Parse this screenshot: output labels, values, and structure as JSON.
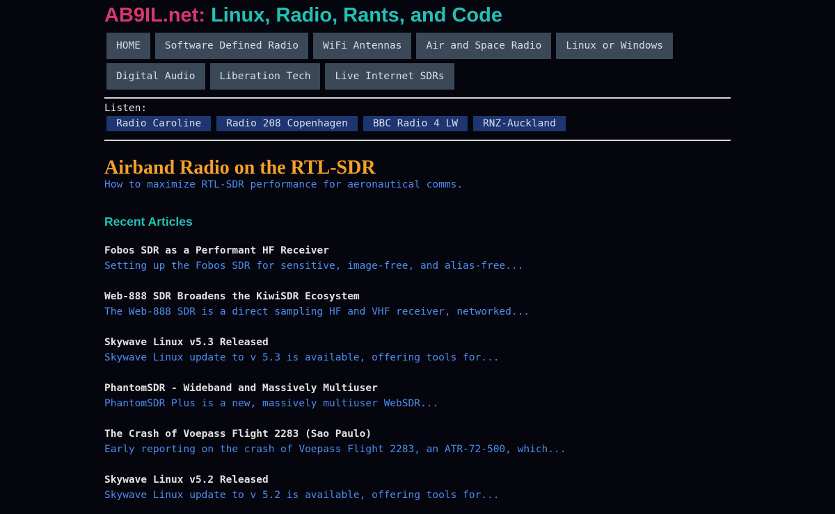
{
  "header": {
    "brand": "AB9IL.net:",
    "tagline": "Linux, Radio, Rants, and Code"
  },
  "nav": {
    "row1": [
      "HOME",
      "Software Defined Radio",
      "WiFi Antennas",
      "Air and Space Radio",
      "Linux or Windows"
    ],
    "row2": [
      "Digital Audio",
      "Liberation Tech",
      "Live Internet SDRs"
    ]
  },
  "listen": {
    "label": "Listen:",
    "stations": [
      "Radio Caroline",
      "Radio 208 Copenhagen",
      "BBC Radio 4 LW",
      "RNZ-Auckland"
    ]
  },
  "feature": {
    "title": "Airband Radio on the RTL-SDR",
    "subtitle": "How to maximize RTL-SDR performance for aeronautical comms."
  },
  "recent": {
    "heading": "Recent Articles",
    "articles": [
      {
        "title": "Fobos SDR as a Performant HF Receiver",
        "summary": "Setting up the Fobos SDR for sensitive, image-free, and alias-free..."
      },
      {
        "title": "Web-888 SDR Broadens the KiwiSDR Ecosystem",
        "summary": "The Web-888 SDR is a direct sampling HF and VHF receiver, networked..."
      },
      {
        "title": "Skywave Linux v5.3 Released",
        "summary": "Skywave Linux update to v 5.3 is available, offering tools for..."
      },
      {
        "title": "PhantomSDR - Wideband and Massively Multiuser",
        "summary": "PhantomSDR Plus is a new, massively multiuser WebSDR..."
      },
      {
        "title": "The Crash of Voepass Flight 2283 (Sao Paulo)",
        "summary": "Early reporting on the crash of Voepass Flight 2283, an ATR-72-500, which..."
      },
      {
        "title": "Skywave Linux v5.2 Released",
        "summary": "Skywave Linux update to v 5.2 is available, offering tools for..."
      }
    ]
  }
}
